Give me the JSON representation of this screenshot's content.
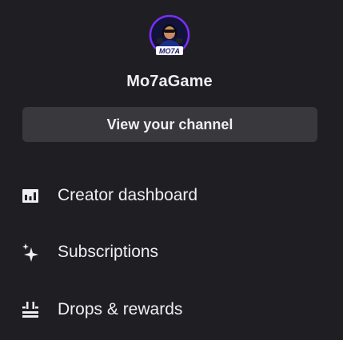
{
  "profile": {
    "username": "Mo7aGame",
    "avatar_text": "MO7A",
    "avatar_icon": "gamer-logo-avatar"
  },
  "channel_button": {
    "label": "View your channel"
  },
  "menu": {
    "items": [
      {
        "label": "Creator dashboard",
        "icon": "bar-chart-icon"
      },
      {
        "label": "Subscriptions",
        "icon": "sparkle-star-icon"
      },
      {
        "label": "Drops & rewards",
        "icon": "drops-gift-icon"
      }
    ]
  },
  "colors": {
    "background": "#1f1f23",
    "button_bg": "#38383d",
    "text": "#efeff1",
    "avatar_ring": "#7b2ff7"
  }
}
